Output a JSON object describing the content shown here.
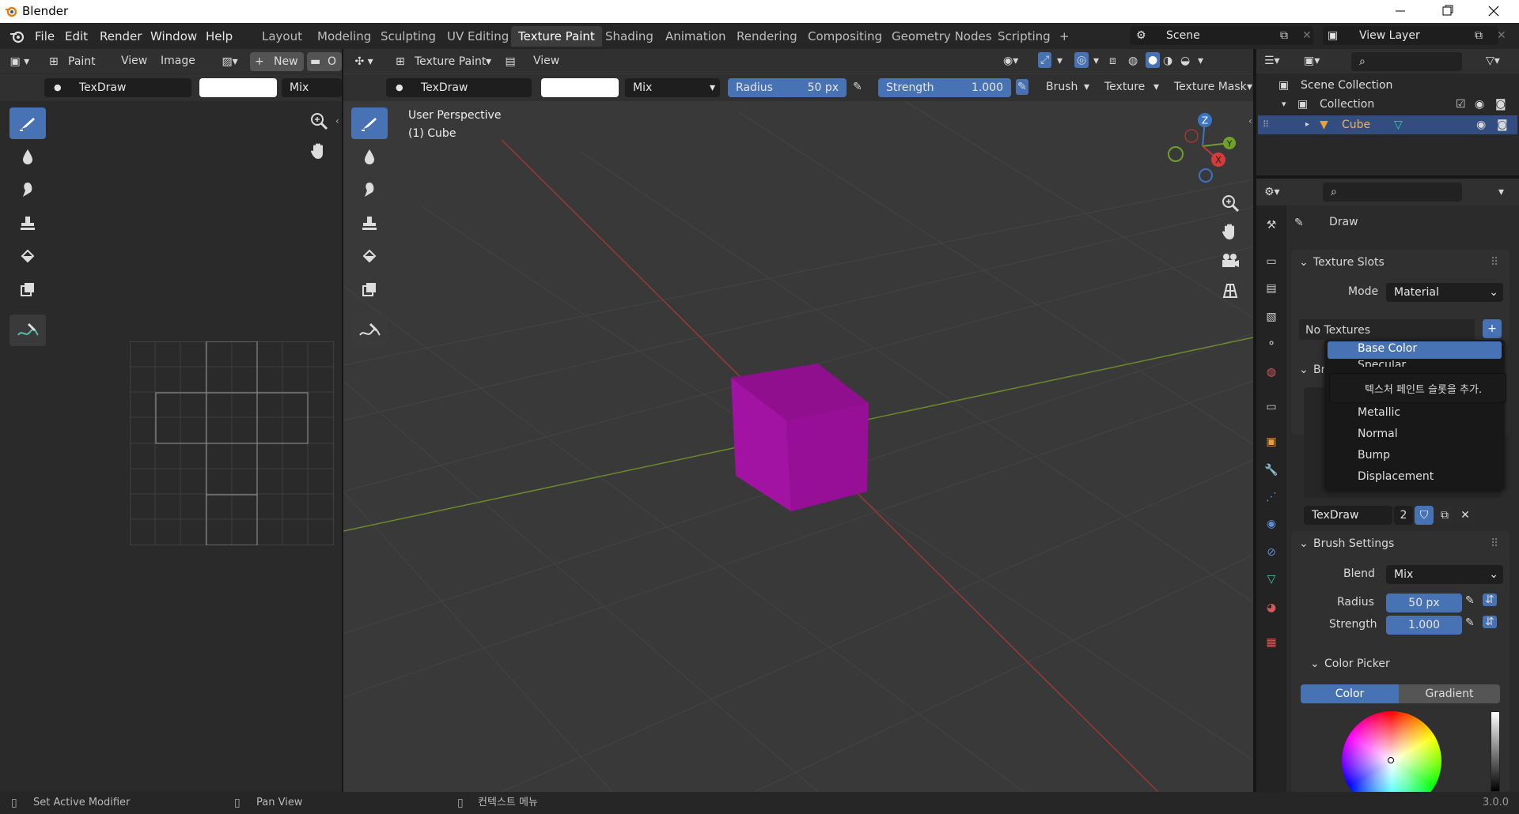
{
  "app": {
    "title": "Blender",
    "version": "3.0.0"
  },
  "menu": [
    "File",
    "Edit",
    "Render",
    "Window",
    "Help"
  ],
  "workspaces": [
    "Layout",
    "Modeling",
    "Sculpting",
    "UV Editing",
    "Texture Paint",
    "Shading",
    "Animation",
    "Rendering",
    "Compositing",
    "Geometry Nodes",
    "Scripting"
  ],
  "active_workspace": "Texture Paint",
  "add_tab_symbol": "+",
  "scene": {
    "name": "Scene",
    "view_layer": "View Layer"
  },
  "image_editor": {
    "mode": "Paint",
    "view": "View",
    "image": "Image",
    "new": "New",
    "open": "O",
    "brush": "TexDraw",
    "blend": "Mix"
  },
  "viewport": {
    "mode": "Texture Paint",
    "view": "View",
    "brush": "TexDraw",
    "blend": "Mix",
    "radius_label": "Radius",
    "radius_value": "50 px",
    "strength_label": "Strength",
    "strength_value": "1.000",
    "brush_menu": "Brush",
    "texture_menu": "Texture",
    "texture_mask_menu": "Texture Mask",
    "overlay_line1": "User Perspective",
    "overlay_line2": "(1) Cube",
    "gizmo": {
      "z": "Z",
      "y": "Y",
      "x": "X"
    },
    "cube_color": "#a313a3"
  },
  "outliner": {
    "scene_collection": "Scene Collection",
    "collection": "Collection",
    "object": "Cube"
  },
  "properties": {
    "tool_name": "Draw",
    "texture_slots": {
      "title": "Texture Slots",
      "mode_label": "Mode",
      "mode_value": "Material",
      "no_textures": "No Textures",
      "add_symbol": "+",
      "brush_abbrev": "Br"
    },
    "texdraw": {
      "name": "TexDraw",
      "users": "2"
    },
    "brush_settings": {
      "title": "Brush Settings",
      "blend_label": "Blend",
      "blend_value": "Mix",
      "radius_label": "Radius",
      "radius_value": "50 px",
      "strength_label": "Strength",
      "strength_value": "1.000"
    },
    "color_picker": {
      "title": "Color Picker",
      "tab_color": "Color",
      "tab_gradient": "Gradient"
    }
  },
  "dropdown": {
    "selected": "Base Color",
    "partial": "Specular",
    "tooltip": "텍스처 페인트 슬롯을 추가.",
    "items": [
      "Metallic",
      "Normal",
      "Bump",
      "Displacement"
    ]
  },
  "statusbar": {
    "item1": "Set Active Modifier",
    "item2": "Pan View",
    "item3": "컨텍스트 메뉴"
  },
  "colors": {
    "accent": "#4772b3",
    "header": "#303030",
    "viewport_bg": "#393939"
  }
}
